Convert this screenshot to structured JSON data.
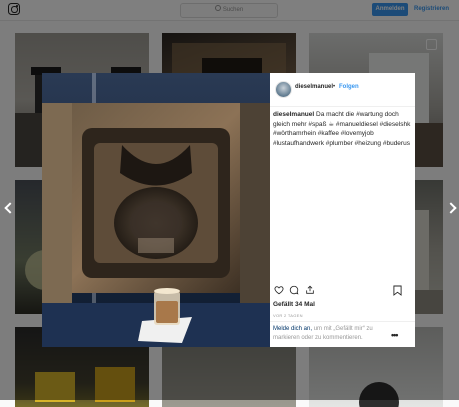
{
  "topbar": {
    "logo_icon": "instagram-icon",
    "search_placeholder": "Suchen",
    "login_label": "Anmelden",
    "register_label": "Registrieren"
  },
  "modal": {
    "username": "dieselmanuel",
    "separator": "•",
    "follow_label": "Folgen",
    "caption": {
      "author": "dieselmanuel",
      "text": "Da macht die #wartung doch gleich mehr #spaß ☕ #manueldiesel #dieselshk #wörthamrhein #kaffee #lovemyjob #lustaufhandwerk #plumber #heizung #buderus"
    },
    "likes_text": "Gefällt 34 Mal",
    "date_text": "VOR 2 TAGEN",
    "login_prompt": {
      "link": "Melde dich an,",
      "text": "um mit „Gefällt mir“ zu markieren oder zu kommentieren."
    },
    "more_label": "•••"
  },
  "colors": {
    "accent": "#3897f0",
    "text": "#262626",
    "muted": "#999999",
    "hashtag": "#003569"
  }
}
